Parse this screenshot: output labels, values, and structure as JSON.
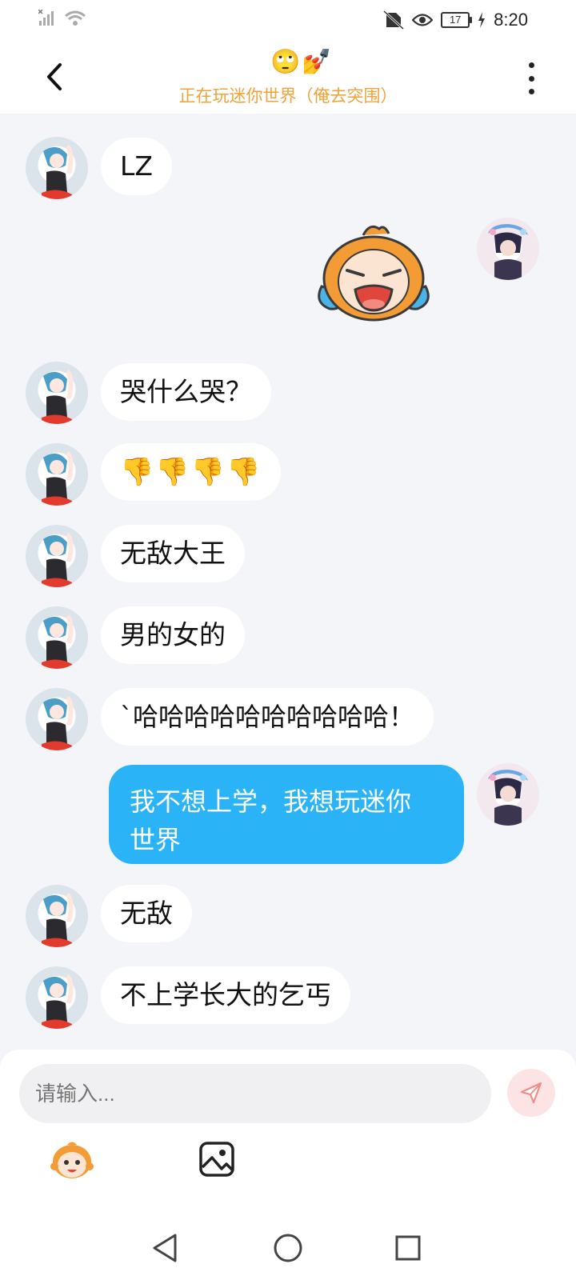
{
  "status_bar": {
    "battery": "17",
    "time": "8:20"
  },
  "header": {
    "title_emoji": "🙄💅",
    "subtitle": "正在玩迷你世界（俺去突围）"
  },
  "messages": [
    {
      "side": "left",
      "type": "text",
      "text": "LZ"
    },
    {
      "side": "right",
      "type": "sticker",
      "sticker": "crying-mascot-sticker"
    },
    {
      "side": "left",
      "type": "text",
      "text": "哭什么哭？"
    },
    {
      "side": "left",
      "type": "text",
      "text": "👎👎👎👎"
    },
    {
      "side": "left",
      "type": "text",
      "text": "无敌大王"
    },
    {
      "side": "left",
      "type": "text",
      "text": "男的女的"
    },
    {
      "side": "left",
      "type": "text",
      "text": "`哈哈哈哈哈哈哈哈哈哈！"
    },
    {
      "side": "right",
      "type": "text",
      "lines": [
        "我不想上学，我想玩迷你",
        "世界"
      ]
    },
    {
      "side": "left",
      "type": "text",
      "text": "无敌"
    },
    {
      "side": "left",
      "type": "text",
      "text": "不上学长大的乞丐"
    }
  ],
  "input": {
    "placeholder": "请输入..."
  },
  "colors": {
    "accent_orange": "#f0a23a",
    "own_bubble": "#2bb3f7",
    "send_button_bg": "#fde4e4",
    "send_icon": "#f28b8b"
  },
  "icons": [
    "back-arrow-icon",
    "more-vertical-icon",
    "send-icon",
    "emoji-mascot-icon",
    "image-icon",
    "nav-back-icon",
    "nav-home-icon",
    "nav-recent-icon"
  ]
}
